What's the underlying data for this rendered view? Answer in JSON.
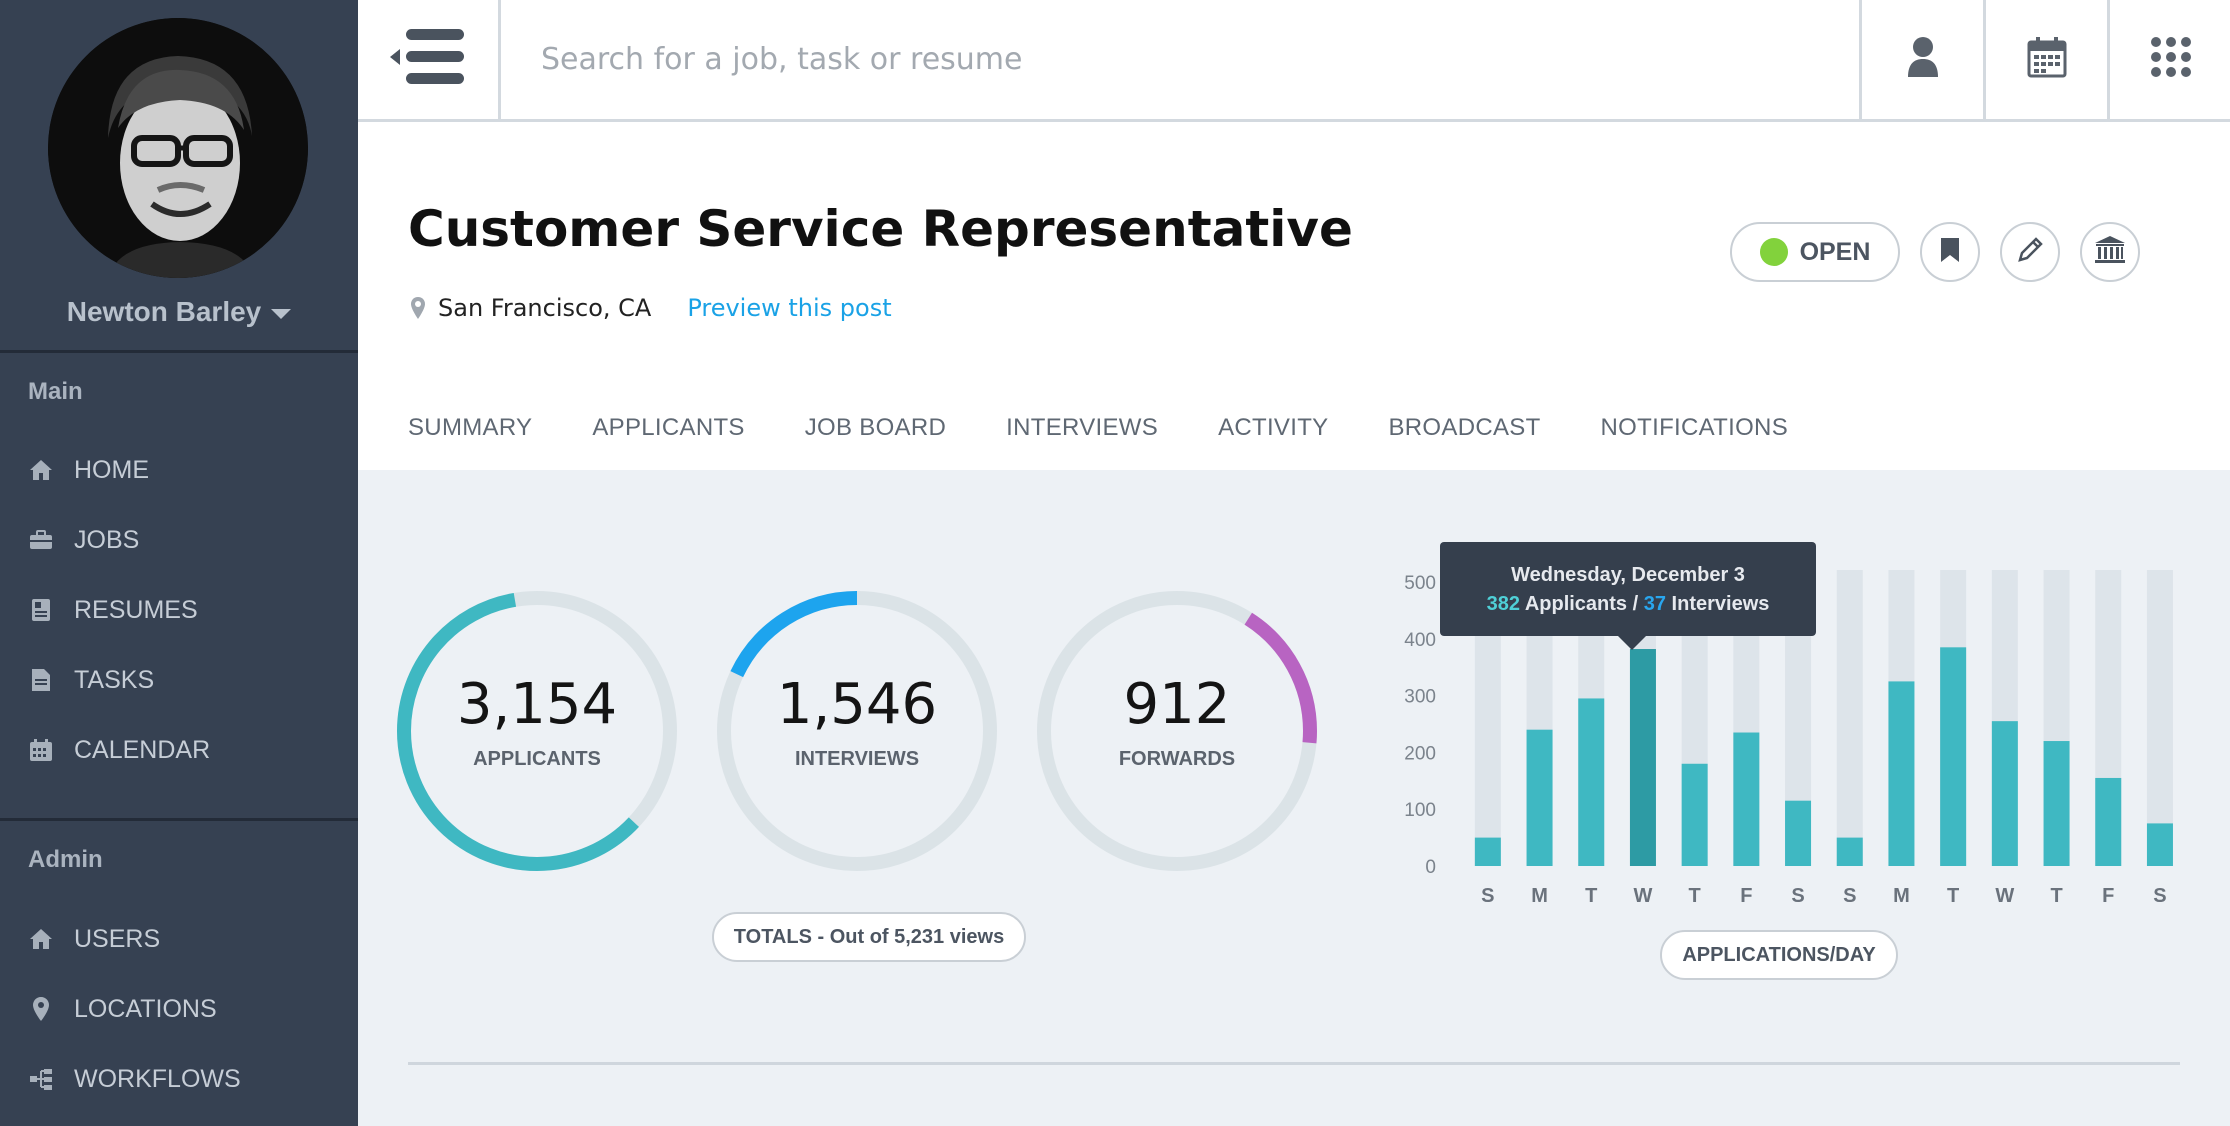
{
  "user": {
    "name": "Newton Barley"
  },
  "sidebar": {
    "sections": [
      {
        "label": "Main",
        "items": [
          {
            "label": "HOME",
            "icon": "home-icon"
          },
          {
            "label": "JOBS",
            "icon": "briefcase-icon"
          },
          {
            "label": "RESUMES",
            "icon": "resume-icon"
          },
          {
            "label": "TASKS",
            "icon": "document-icon"
          },
          {
            "label": "CALENDAR",
            "icon": "calendar-icon"
          }
        ]
      },
      {
        "label": "Admin",
        "items": [
          {
            "label": "USERS",
            "icon": "home-icon"
          },
          {
            "label": "LOCATIONS",
            "icon": "map-pin-icon"
          },
          {
            "label": "WORKFLOWS",
            "icon": "workflow-icon"
          }
        ]
      }
    ]
  },
  "topbar": {
    "search_placeholder": "Search for a job, task or resume",
    "icons": [
      "menu-icon",
      "user-icon",
      "calendar-icon",
      "apps-grid-icon"
    ]
  },
  "job": {
    "title": "Customer Service Representative",
    "location": "San Francisco, CA",
    "preview_link": "Preview this post",
    "status": "OPEN",
    "status_color": "#82d23c",
    "actions": [
      "bookmark-icon",
      "edit-icon",
      "bank-icon"
    ]
  },
  "tabs": [
    "SUMMARY",
    "APPLICANTS",
    "JOB BOARD",
    "INTERVIEWS",
    "ACTIVITY",
    "BROADCAST",
    "NOTIFICATIONS"
  ],
  "stats": {
    "rings": [
      {
        "value": "3,154",
        "label": "APPLICANTS",
        "fraction": 0.603,
        "color": "#3fb8c2"
      },
      {
        "value": "1,546",
        "label": "INTERVIEWS",
        "fraction": 0.296,
        "color": "#1da4ee"
      },
      {
        "value": "912",
        "label": "FORWARDS",
        "fraction": 0.174,
        "color": "#b864c2"
      }
    ],
    "caption": "TOTALS - Out of 5,231 views"
  },
  "chart_data": {
    "type": "bar",
    "categories": [
      "S",
      "M",
      "T",
      "W",
      "T",
      "F",
      "S",
      "S",
      "M",
      "T",
      "W",
      "T",
      "F",
      "S"
    ],
    "values": [
      50,
      240,
      295,
      382,
      180,
      235,
      115,
      50,
      325,
      385,
      255,
      220,
      155,
      75
    ],
    "ylim": [
      0,
      500
    ],
    "yticks": [
      "500",
      "400",
      "300",
      "200",
      "100",
      "0"
    ],
    "highlight_index": 3,
    "bar_color": "#3fb8c2",
    "highlight_color": "#2d9ba4",
    "track_color": "#dde4ea",
    "tooltip": {
      "title": "Wednesday, December 3",
      "applicants": "382",
      "applicants_label": "Applicants /",
      "interviews": "37",
      "interviews_label": "Interviews"
    },
    "caption": "APPLICATIONS/DAY"
  }
}
